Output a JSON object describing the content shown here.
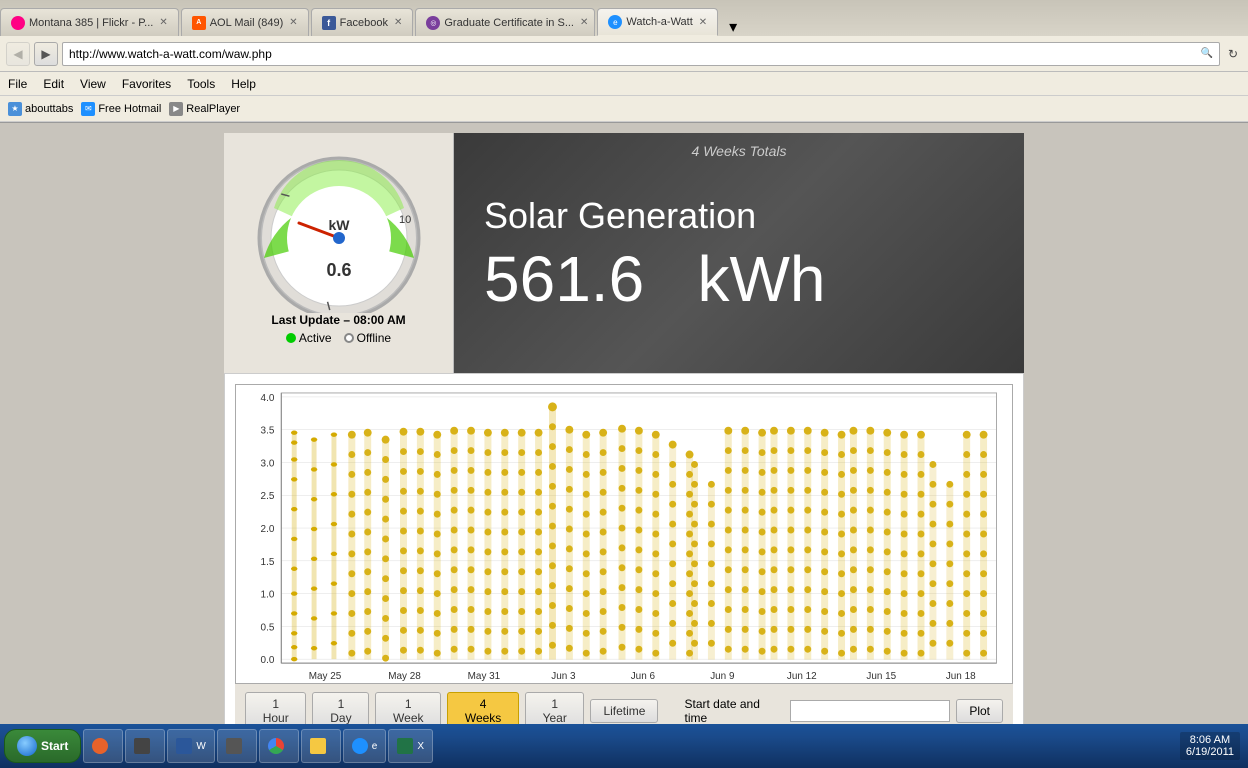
{
  "browser": {
    "tabs": [
      {
        "id": "tab1",
        "label": "Montana 385 | Flickr - P...",
        "icon": "flickr",
        "active": false
      },
      {
        "id": "tab2",
        "label": "AOL Mail (849)",
        "icon": "aol",
        "active": false
      },
      {
        "id": "tab3",
        "label": "Facebook",
        "icon": "facebook",
        "active": false
      },
      {
        "id": "tab4",
        "label": "Graduate Certificate in S...",
        "icon": "edge",
        "active": false
      },
      {
        "id": "tab5",
        "label": "Watch-a-Watt",
        "icon": "ie",
        "active": true
      }
    ],
    "address": "http://www.watch-a-watt.com/waw.php",
    "menu": [
      "File",
      "Edit",
      "View",
      "Favorites",
      "Tools",
      "Help"
    ],
    "bookmarks": [
      {
        "label": "abouttabs"
      },
      {
        "label": "Free Hotmail"
      },
      {
        "label": "RealPlayer"
      }
    ]
  },
  "gauge": {
    "value": "0.6",
    "unit": "kW",
    "max": 10,
    "last_update": "Last Update – 08:00 AM",
    "status_active": "Active",
    "status_offline": "Offline"
  },
  "solar": {
    "weeks_label": "4 Weeks Totals",
    "title": "Solar Generation",
    "value": "561.6",
    "unit": "kWh"
  },
  "chart": {
    "y_labels": [
      "4.0",
      "3.5",
      "3.0",
      "2.5",
      "2.0",
      "1.5",
      "1.0",
      "0.5",
      "0.0"
    ],
    "x_labels": [
      "May 25",
      "May 28",
      "May 31",
      "Jun 3",
      "Jun 6",
      "Jun 9",
      "Jun 12",
      "Jun 15",
      "Jun 18"
    ]
  },
  "controls": {
    "buttons": [
      "1 Hour",
      "1 Day",
      "1 Week",
      "4 Weeks",
      "1 Year",
      "Lifetime"
    ],
    "active_button": "4 Weeks",
    "start_date_label": "Start date and time",
    "plot_label": "Plot"
  },
  "taskbar": {
    "start_label": "Start",
    "clock": "8:06 AM\n6/19/2011",
    "items": [
      {
        "label": "Firefox",
        "color": "#e8622a"
      },
      {
        "label": "Media",
        "color": "#444"
      },
      {
        "label": "Word",
        "color": "#2b579a"
      },
      {
        "label": "App",
        "color": "#444"
      },
      {
        "label": "Chrome",
        "color": "#e8aa00"
      },
      {
        "label": "Files",
        "color": "#f5c842"
      },
      {
        "label": "IE",
        "color": "#1e90ff"
      },
      {
        "label": "Excel",
        "color": "#217346"
      }
    ]
  }
}
